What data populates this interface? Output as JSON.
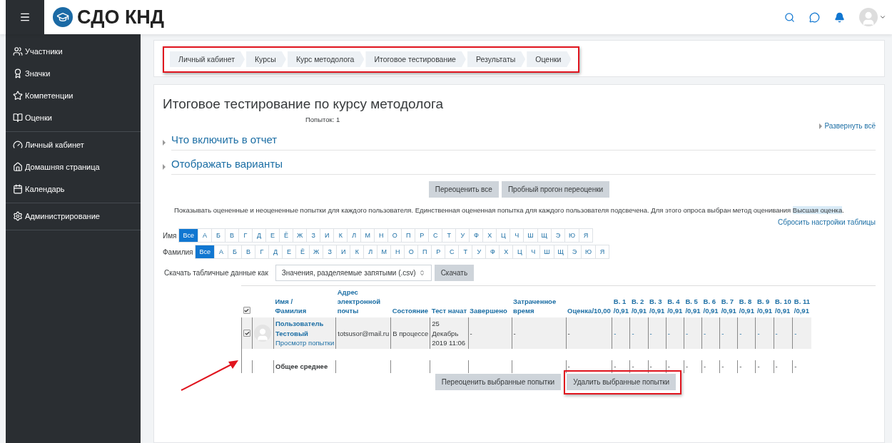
{
  "header": {
    "logo_text": "СДО КНД"
  },
  "sidebar": {
    "groups": [
      [
        "Участники",
        "Значки",
        "Компетенции",
        "Оценки"
      ],
      [
        "Личный кабинет",
        "Домашняя страница",
        "Календарь"
      ],
      [
        "Администрирование"
      ]
    ]
  },
  "breadcrumb": [
    "Личный кабинет",
    "Курсы",
    "Курс методолога",
    "Итоговое тестирование",
    "Результаты",
    "Оценки"
  ],
  "title": "Итоговое тестирование по курсу методолога",
  "attempts": "Попыток: 1",
  "expand_all": "Развернуть всё",
  "sections": [
    {
      "label": "Что включить в отчет",
      "expanded": false
    },
    {
      "label": "Отображать варианты",
      "expanded": false
    }
  ],
  "regrade_buttons": [
    "Переоценить все",
    "Пробный прогон переоценки"
  ],
  "info": {
    "text": "Показывать оцененные и неоцененные попытки для каждого пользователя. Единственная оцененная попытка для каждого пользователя подсвечена. Для этого опроса выбран метод оценивания ",
    "method": "Высшая оценка",
    "end": "."
  },
  "reset_link": "Сбросить настройки таблицы",
  "filters": [
    {
      "label": "Имя",
      "letters": [
        {
          "label": "Все",
          "selected": true
        },
        {
          "label": "А",
          "selected": false
        },
        {
          "label": "Б",
          "selected": false
        },
        {
          "label": "В",
          "selected": false
        },
        {
          "label": "Г",
          "selected": false
        },
        {
          "label": "Д",
          "selected": false
        },
        {
          "label": "Е",
          "selected": false
        },
        {
          "label": "Ё",
          "selected": false
        },
        {
          "label": "Ж",
          "selected": false
        },
        {
          "label": "З",
          "selected": false
        },
        {
          "label": "И",
          "selected": false
        },
        {
          "label": "К",
          "selected": false
        },
        {
          "label": "Л",
          "selected": false
        },
        {
          "label": "М",
          "selected": false
        },
        {
          "label": "Н",
          "selected": false
        },
        {
          "label": "О",
          "selected": false
        },
        {
          "label": "П",
          "selected": false
        },
        {
          "label": "Р",
          "selected": false
        },
        {
          "label": "С",
          "selected": false
        },
        {
          "label": "Т",
          "selected": false
        },
        {
          "label": "У",
          "selected": false
        },
        {
          "label": "Ф",
          "selected": false
        },
        {
          "label": "Х",
          "selected": false
        },
        {
          "label": "Ц",
          "selected": false
        },
        {
          "label": "Ч",
          "selected": false
        },
        {
          "label": "Ш",
          "selected": false
        },
        {
          "label": "Щ",
          "selected": false
        },
        {
          "label": "Э",
          "selected": false
        },
        {
          "label": "Ю",
          "selected": false
        },
        {
          "label": "Я",
          "selected": false
        }
      ]
    },
    {
      "label": "Фамилия",
      "letters": [
        {
          "label": "Все",
          "selected": true
        },
        {
          "label": "А",
          "selected": false
        },
        {
          "label": "Б",
          "selected": false
        },
        {
          "label": "В",
          "selected": false
        },
        {
          "label": "Г",
          "selected": false
        },
        {
          "label": "Д",
          "selected": false
        },
        {
          "label": "Е",
          "selected": false
        },
        {
          "label": "Ё",
          "selected": false
        },
        {
          "label": "Ж",
          "selected": false
        },
        {
          "label": "З",
          "selected": false
        },
        {
          "label": "И",
          "selected": false
        },
        {
          "label": "К",
          "selected": false
        },
        {
          "label": "Л",
          "selected": false
        },
        {
          "label": "М",
          "selected": false
        },
        {
          "label": "Н",
          "selected": false
        },
        {
          "label": "О",
          "selected": false
        },
        {
          "label": "П",
          "selected": false
        },
        {
          "label": "Р",
          "selected": false
        },
        {
          "label": "С",
          "selected": false
        },
        {
          "label": "Т",
          "selected": false
        },
        {
          "label": "У",
          "selected": false
        },
        {
          "label": "Ф",
          "selected": false
        },
        {
          "label": "Х",
          "selected": false
        },
        {
          "label": "Ц",
          "selected": false
        },
        {
          "label": "Ч",
          "selected": false
        },
        {
          "label": "Ш",
          "selected": false
        },
        {
          "label": "Щ",
          "selected": false
        },
        {
          "label": "Э",
          "selected": false
        },
        {
          "label": "Ю",
          "selected": false
        },
        {
          "label": "Я",
          "selected": false
        }
      ]
    }
  ],
  "download": {
    "label": "Скачать табличные данные как",
    "format": "Значения, разделяемые запятыми (.csv)",
    "button": "Скачать"
  },
  "table": {
    "select_all_checked": true,
    "name_header": [
      "Имя",
      "/",
      "Фамилия"
    ],
    "columns": [
      "Адрес электронной почты",
      "Состояние",
      "Тест начат",
      "Завершено",
      "Затраченное время",
      "Оценка/10,00"
    ],
    "questions": [
      {
        "label": "В. 1",
        "max": "/0,91"
      },
      {
        "label": "В. 2",
        "max": "/0,91"
      },
      {
        "label": "В. 3",
        "max": "/0,91"
      },
      {
        "label": "В. 4",
        "max": "/0,91"
      },
      {
        "label": "В. 5",
        "max": "/0,91"
      },
      {
        "label": "В. 6",
        "max": "/0,91"
      },
      {
        "label": "В. 7",
        "max": "/0,91"
      },
      {
        "label": "В. 8",
        "max": "/0,91"
      },
      {
        "label": "В. 9",
        "max": "/0,91"
      },
      {
        "label": "В. 10",
        "max": "/0,91"
      },
      {
        "label": "В. 11",
        "max": "/0,91"
      }
    ],
    "rows": [
      {
        "selected": true,
        "name": "Пользователь Тестовый",
        "review": "Просмотр попытки",
        "cells": [
          "totsusor@mail.ru",
          "В процессе",
          "25 Декабрь 2019 11:06",
          "-",
          "-",
          "-"
        ],
        "marks": [
          "-",
          "-",
          "-",
          "-",
          "-",
          "-",
          "-",
          "-",
          "-",
          "-",
          "-"
        ]
      }
    ],
    "summary": {
      "label": "Общее среднее",
      "grade": "-",
      "marks": [
        "-",
        "-",
        "-",
        "-",
        "-",
        "-",
        "-",
        "-",
        "-",
        "-",
        "-"
      ]
    }
  },
  "bottom_buttons": [
    "Переоценить выбранные попытки",
    "Удалить выбранные попытки"
  ]
}
